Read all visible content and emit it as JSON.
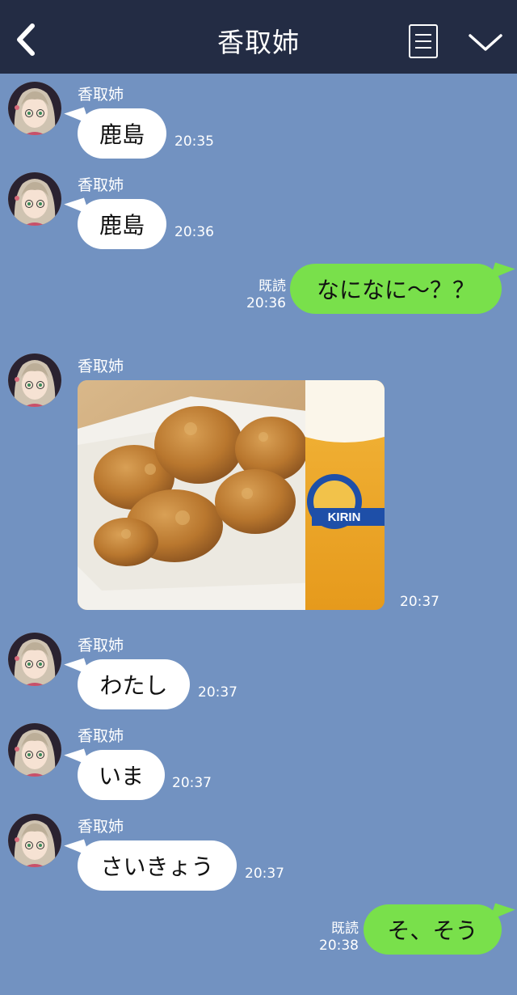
{
  "header": {
    "title": "香取姉",
    "back_icon": "chevron-left-icon",
    "menu_icon": "list-icon",
    "down_icon": "chevron-down-icon"
  },
  "colors": {
    "header_bg": "#232c44",
    "chat_bg": "#7292c1",
    "incoming_bubble": "#ffffff",
    "outgoing_bubble": "#79e04b"
  },
  "messages": [
    {
      "direction": "in",
      "sender": "香取姉",
      "text": "鹿島",
      "time": "20:35"
    },
    {
      "direction": "in",
      "sender": "香取姉",
      "text": "鹿島",
      "time": "20:36"
    },
    {
      "direction": "out",
      "text": "なになに～？？",
      "read": "既読",
      "time": "20:36"
    },
    {
      "direction": "in",
      "sender": "香取姉",
      "type": "image",
      "image_desc": "karaage-and-beer-photo",
      "beer_label": "KIRIN",
      "time": "20:37"
    },
    {
      "direction": "in",
      "sender": "香取姉",
      "text": "わたし",
      "time": "20:37"
    },
    {
      "direction": "in",
      "sender": "香取姉",
      "text": "いま",
      "time": "20:37"
    },
    {
      "direction": "in",
      "sender": "香取姉",
      "text": "さいきょう",
      "time": "20:37"
    },
    {
      "direction": "out",
      "text": "そ、そう",
      "read": "既読",
      "time": "20:38"
    }
  ]
}
